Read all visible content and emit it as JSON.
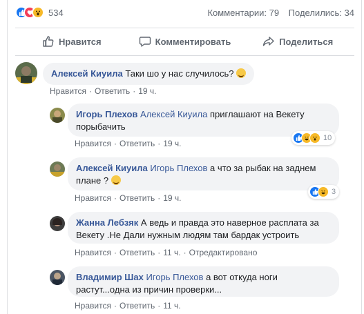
{
  "post": {
    "reaction_count": "534",
    "comments_text": "Комментарии: 79",
    "shares_text": "Поделились: 34",
    "reaction_types": [
      "like-icon",
      "love-icon",
      "wow-icon"
    ]
  },
  "actions": {
    "like": "Нравится",
    "comment": "Комментировать",
    "share": "Поделиться"
  },
  "comments": [
    {
      "author": "Алексей Киуила",
      "text": "Таки шо у нас случилось?",
      "like": "Нравится",
      "reply": "Ответить",
      "time": "19 ч."
    },
    {
      "author": "Игорь Плехов",
      "mention": "Алексей Киуила",
      "text1": "приглашают на Векету",
      "text2": "порыбачить",
      "like": "Нравится",
      "reply": "Ответить",
      "time": "19 ч.",
      "reactions": "10"
    },
    {
      "author": "Алексей Киуила",
      "mention": "Игорь Плехов",
      "text1": "а что за рыбак на заднем",
      "text2": "плане ?",
      "like": "Нравится",
      "reply": "Ответить",
      "time": "19 ч.",
      "reactions": "3"
    },
    {
      "author": "Жанна Лебзяк",
      "text1": "А ведь и правда это наверное расплата за",
      "text2": "Векету .Не Дали нужным людям там бардак устроить",
      "like": "Нравится",
      "reply": "Ответить",
      "time": "11 ч.",
      "edited": "Отредактировано"
    },
    {
      "author": "Владимир Шах",
      "mention": "Игорь Плехов",
      "text1": "а вот откуда ноги",
      "text2": "растут...одна из причин проверки...",
      "like": "Нравится",
      "reply": "Ответить",
      "time": "11 ч."
    }
  ],
  "colors": {
    "link": "#385898",
    "muted": "#606770",
    "bubble": "#f2f3f5",
    "like_blue": "#1877f2"
  }
}
